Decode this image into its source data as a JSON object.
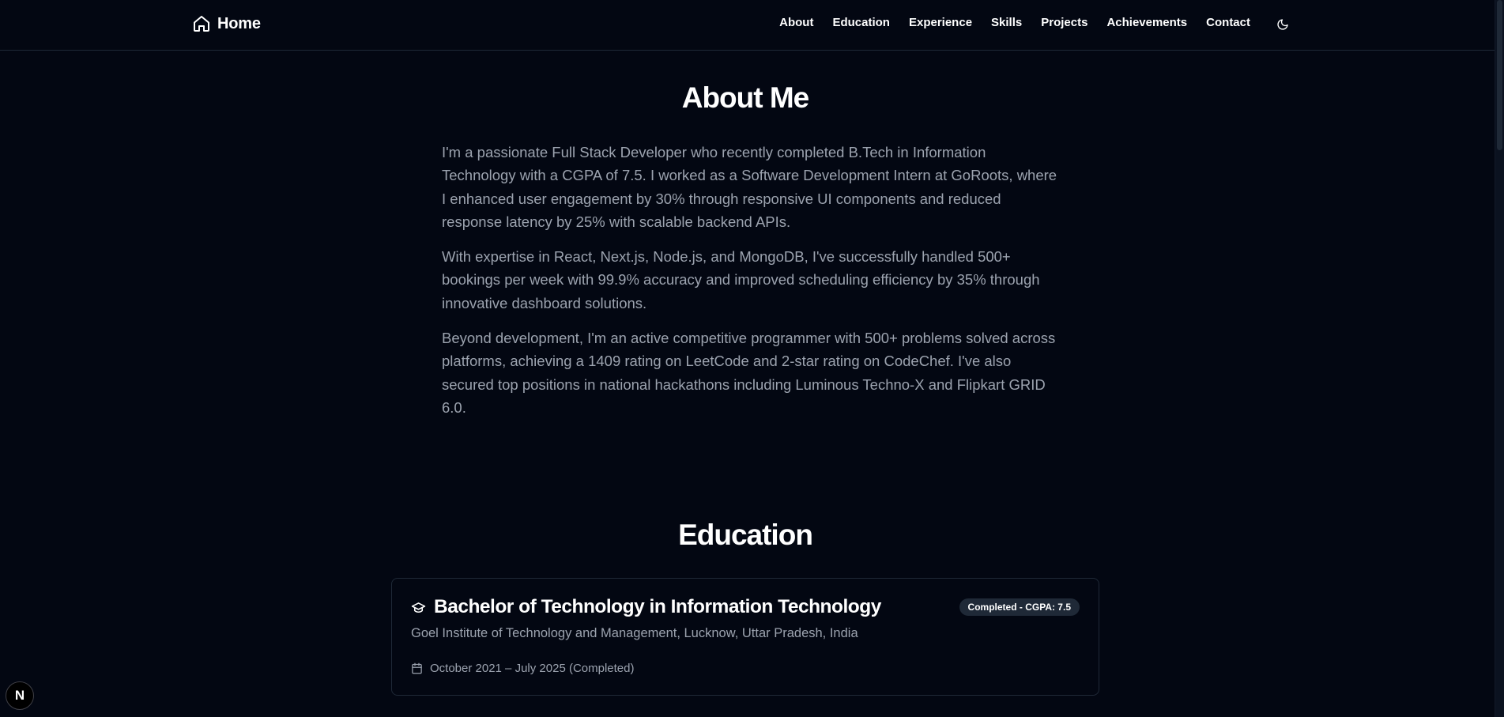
{
  "header": {
    "brand_label": "Home",
    "nav": [
      "About",
      "Education",
      "Experience",
      "Skills",
      "Projects",
      "Achievements",
      "Contact"
    ],
    "theme_icon": "moon-icon"
  },
  "about": {
    "title": "About Me",
    "paragraphs": [
      "I'm a passionate Full Stack Developer who recently completed B.Tech in Information Technology with a CGPA of 7.5. I worked as a Software Development Intern at GoRoots, where I enhanced user engagement by 30% through responsive UI components and reduced response latency by 25% with scalable backend APIs.",
      "With expertise in React, Next.js, Node.js, and MongoDB, I've successfully handled 500+ bookings per week with 99.9% accuracy and improved scheduling efficiency by 35% through innovative dashboard solutions.",
      "Beyond development, I'm an active competitive programmer with 500+ problems solved across platforms, achieving a 1409 rating on LeetCode and 2-star rating on CodeChef. I've also secured top positions in national hackathons including Luminous Techno-X and Flipkart GRID 6.0."
    ]
  },
  "education": {
    "title": "Education",
    "items": [
      {
        "degree": "Bachelor of Technology in Information Technology",
        "badge": "Completed - CGPA: 7.5",
        "school": "Goel Institute of Technology and Management, Lucknow, Uttar Pradesh, India",
        "dates": "October 2021 – July 2025 (Completed)"
      }
    ]
  },
  "dev_indicator": {
    "label": "N"
  },
  "colors": {
    "background": "#030712",
    "text_muted": "#9ca3af",
    "border": "#1f2937",
    "badge_bg": "#1f2937"
  }
}
